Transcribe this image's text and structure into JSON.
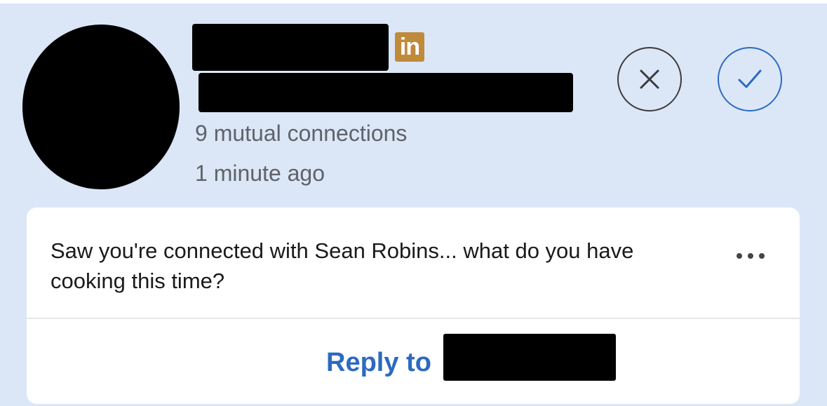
{
  "invitation": {
    "badge_text": "in",
    "mutual_connections": "9 mutual connections",
    "timestamp": "1 minute ago"
  },
  "actions": {
    "decline_icon": "close-icon",
    "accept_icon": "checkmark-icon"
  },
  "message": {
    "text": "Saw you're connected with Sean Robins... what do you have cooking this time?",
    "more_icon": "more-horizontal-icon"
  },
  "reply": {
    "label": "Reply to"
  },
  "colors": {
    "background": "#dbe7f7",
    "accent_blue": "#2d6ac0",
    "linkedin_badge": "#c08a3b",
    "meta_text": "#5f6368"
  }
}
